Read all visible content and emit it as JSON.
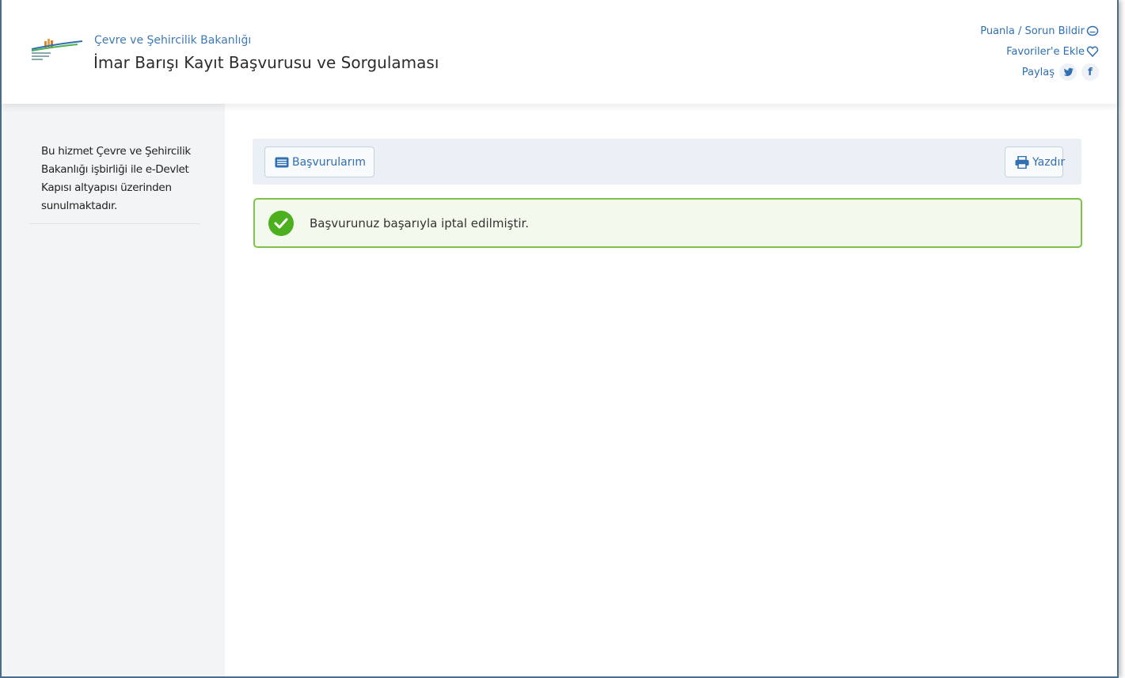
{
  "header": {
    "ministry": "Çevre ve Şehircilik Bakanlığı",
    "service_title": "İmar Barışı Kayıt Başvurusu ve Sorgulaması",
    "links": {
      "rate_report": "Puanla / Sorun Bildir",
      "add_favorites": "Favoriler'e Ekle",
      "share": "Paylaş"
    },
    "icons": [
      "chat-icon",
      "heart-icon",
      "twitter-icon",
      "facebook-icon"
    ]
  },
  "sidebar": {
    "info_text": "Bu hizmet Çevre ve Şehircilik Bakanlığı işbirliği ile e-Devlet Kapısı altyapısı üzerinden sunulmaktadır."
  },
  "toolbar": {
    "applications_label": "Başvurularım",
    "print_label": "Yazdır"
  },
  "alert": {
    "message": "Başvurunuz başarıyla iptal edilmiştir.",
    "type": "success"
  },
  "colors": {
    "accent": "#2f6fb2",
    "success_border": "#7fc34a",
    "success_icon": "#4caf1e",
    "frame_border": "#4a6d8f"
  }
}
